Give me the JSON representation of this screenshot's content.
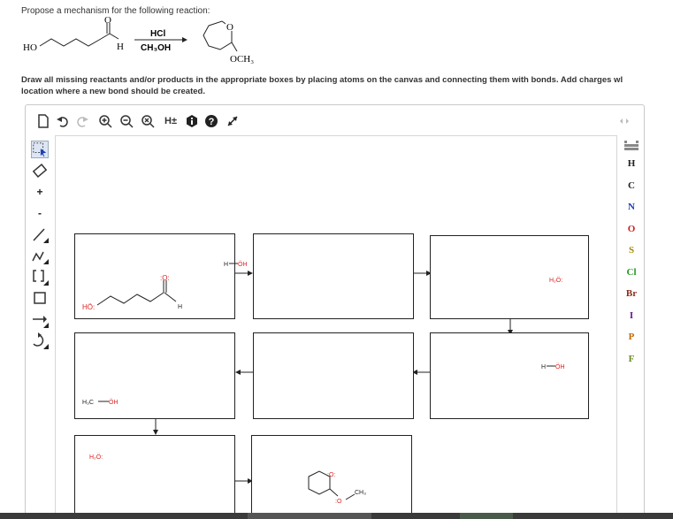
{
  "question": "Propose a mechanism for the following reaction:",
  "instructions": {
    "line1": "Draw all missing reactants and/or products in the appropriate boxes by placing atoms on the canvas and connecting them with bonds. Add charges wl",
    "line2": "location where a new bond should be created."
  },
  "reaction": {
    "reactant_oh": "HO",
    "reactant_o": "O",
    "reactant_h": "H",
    "reagent1": "HCl",
    "reagent2": "CH₃OH",
    "product_o": "O",
    "product_och3": "OCH₃"
  },
  "toolbar": {
    "hpm": "H±"
  },
  "elements": [
    "H",
    "C",
    "N",
    "O",
    "S",
    "Cl",
    "Br",
    "I",
    "P",
    "F"
  ],
  "element_colors": {
    "H": "#222222",
    "C": "#222222",
    "N": "#1a3fb8",
    "O": "#cc2222",
    "S": "#a08800",
    "Cl": "#229922",
    "Br": "#8b2c1a",
    "I": "#6a1a8a",
    "P": "#c06a00",
    "F": "#6a8a22"
  },
  "canvas": {
    "box1_ho": "HÖ:",
    "box1_o": ":O:",
    "box1_h": "H",
    "hoh_top_h": "H",
    "hoh_top_oh": "ÖH",
    "box3_water": "H₂Ö:",
    "hoh_mid_h": "H",
    "hoh_mid_oh": "ÖH",
    "box4_h3c": "H₃C",
    "box4_oh": "ÖH",
    "box7_water": "H₂Ö:",
    "box8_o": ":O:",
    "box8_o2": ":O",
    "box8_ch3": "CH₃"
  }
}
